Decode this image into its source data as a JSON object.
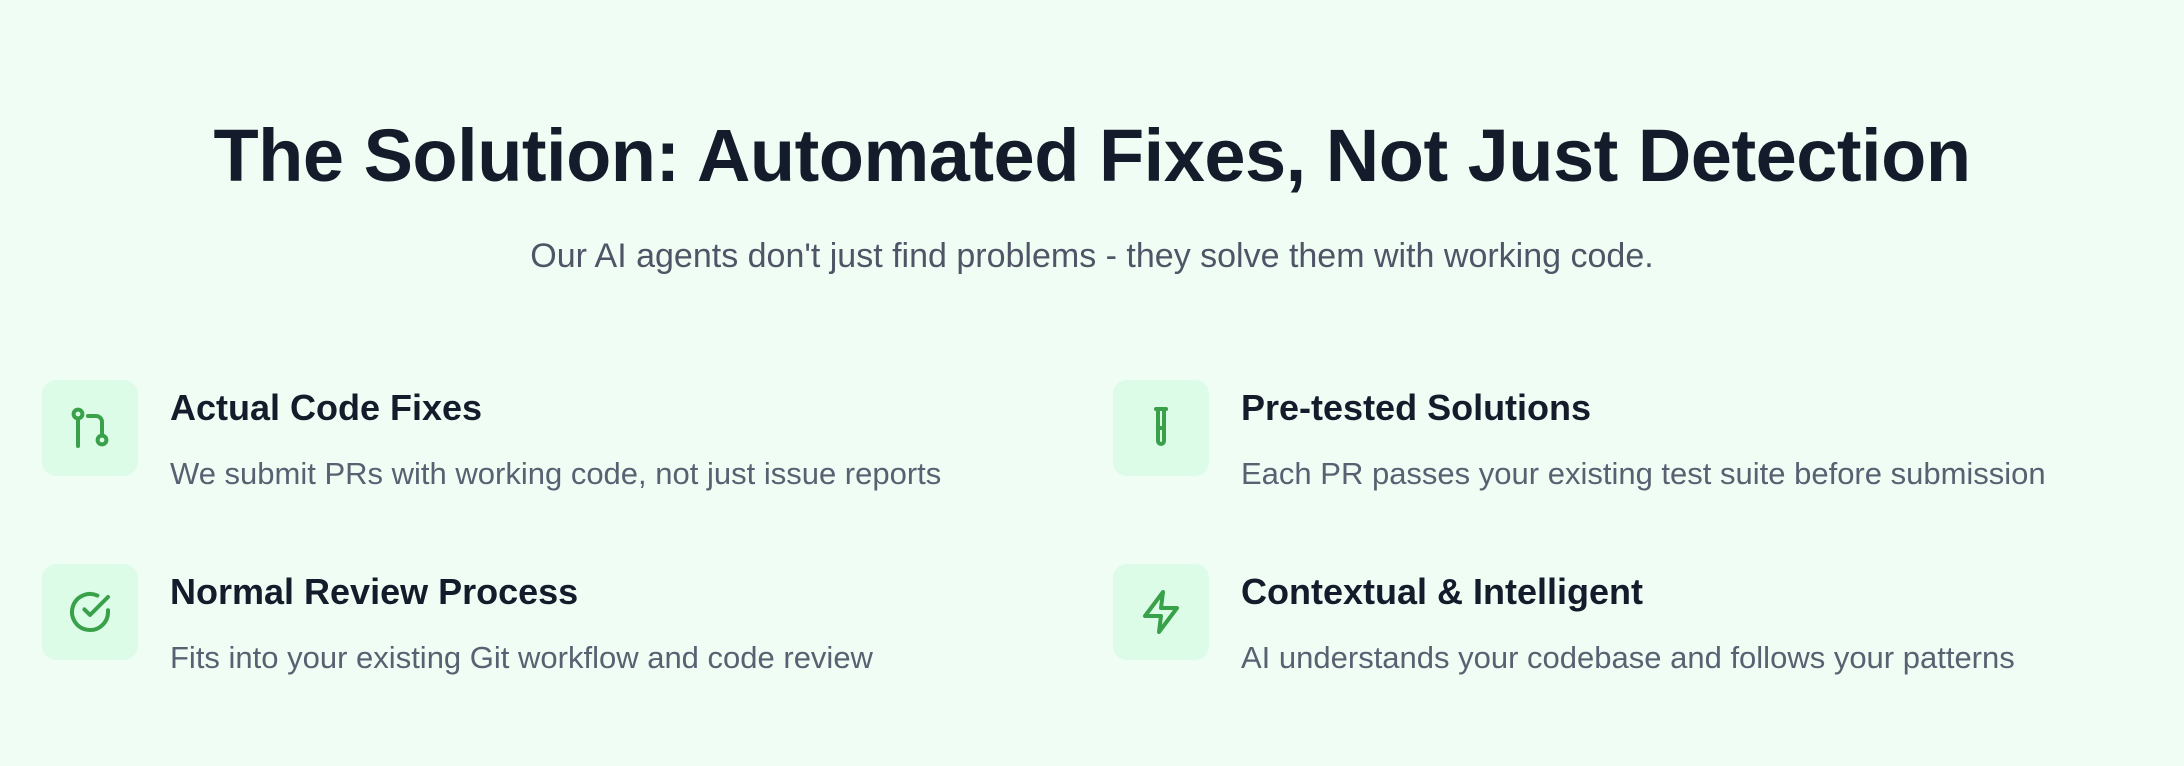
{
  "section": {
    "title": "The Solution: Automated Fixes, Not Just Detection",
    "subtitle": "Our AI agents don't just find problems - they solve them with working code.",
    "accent_color": "#3aa14b",
    "icon_bg_color": "#dcfce7",
    "background_color": "#f0fdf4"
  },
  "features": [
    {
      "icon": "git-pull-request-icon",
      "title": "Actual Code Fixes",
      "description": "We submit PRs with working code, not just issue reports"
    },
    {
      "icon": "test-tube-icon",
      "title": "Pre-tested Solutions",
      "description": "Each PR passes your existing test suite before submission"
    },
    {
      "icon": "check-circle-icon",
      "title": "Normal Review Process",
      "description": "Fits into your existing Git workflow and code review"
    },
    {
      "icon": "lightning-bolt-icon",
      "title": "Contextual & Intelligent",
      "description": "AI understands your codebase and follows your patterns"
    }
  ]
}
